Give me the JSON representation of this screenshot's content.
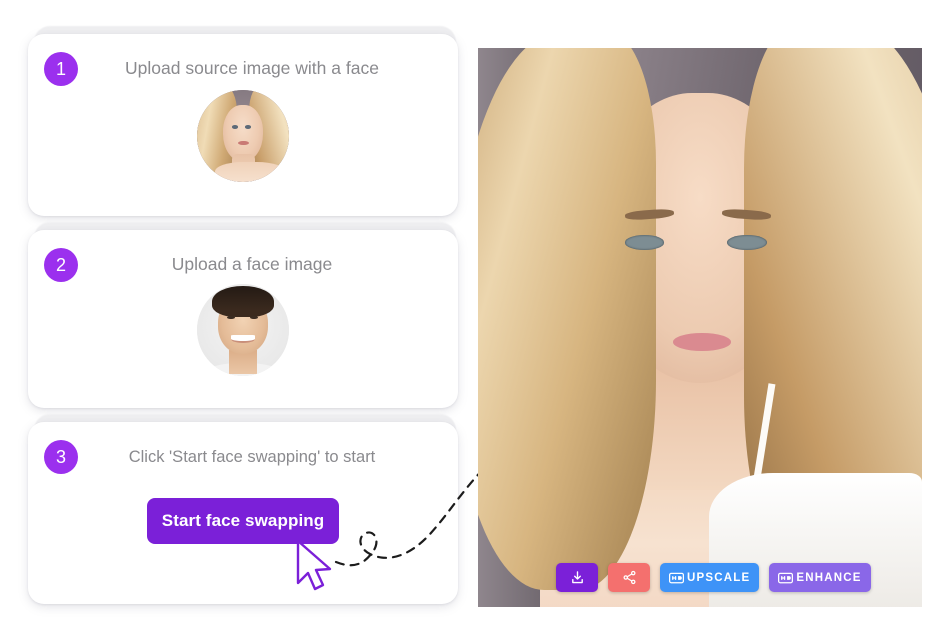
{
  "app": {
    "colors": {
      "badge_purple": "#9B30EE",
      "primary_button": "#7B20D8",
      "share_red": "#F4706E",
      "upscale_blue": "#3E93F7",
      "enhance_violet": "#8A67E8",
      "title_gray": "#8A8A8E"
    }
  },
  "steps": [
    {
      "number": "1",
      "title": "Upload source image with a face",
      "thumbnail": "female-portrait-thumbnail"
    },
    {
      "number": "2",
      "title": "Upload a face image",
      "thumbnail": "male-portrait-thumbnail"
    },
    {
      "number": "3",
      "title": "Click 'Start face swapping' to start",
      "button_label": "Start face swapping",
      "cursor": "mouse-pointer-cursor"
    }
  ],
  "result": {
    "image_description": "blonde-woman-portrait-result",
    "toolbar": [
      {
        "id": "download",
        "label": "",
        "icon": "download-icon",
        "color": "#7B20D8"
      },
      {
        "id": "share",
        "label": "",
        "icon": "share-icon",
        "color": "#F4706E"
      },
      {
        "id": "upscale",
        "label": "UPSCALE",
        "icon": "hd-icon",
        "color": "#3E93F7"
      },
      {
        "id": "enhance",
        "label": "ENHANCE",
        "icon": "hd-icon",
        "color": "#8A67E8"
      }
    ]
  }
}
